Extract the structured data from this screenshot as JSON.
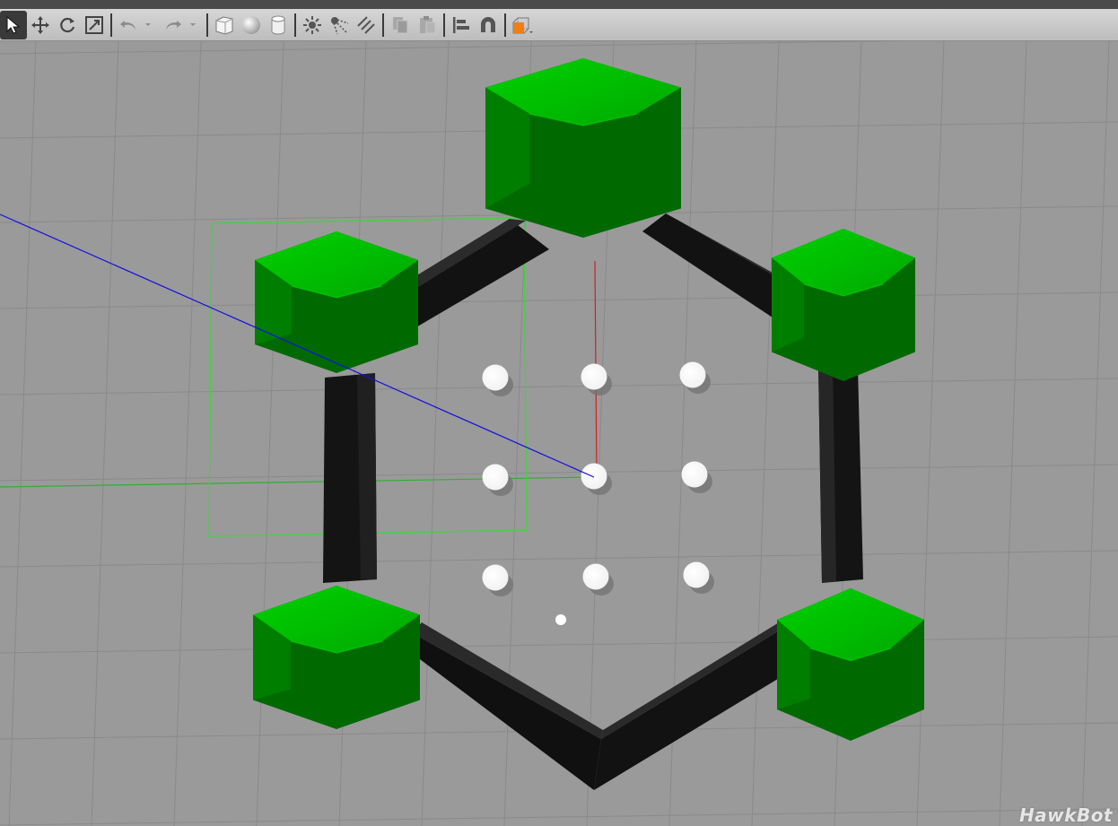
{
  "app": {
    "watermark": "HawkBot"
  },
  "toolbar": {
    "tools": [
      {
        "name": "select-mode-button",
        "icon": "arrow-cursor-icon",
        "active": true
      },
      {
        "name": "translate-mode-button",
        "icon": "move-arrows-icon"
      },
      {
        "name": "rotate-mode-button",
        "icon": "rotate-icon"
      },
      {
        "name": "scale-mode-button",
        "icon": "scale-icon"
      },
      {
        "name": "undo-button",
        "icon": "undo-icon",
        "disabled": true
      },
      {
        "name": "redo-button",
        "icon": "redo-icon",
        "disabled": true
      },
      {
        "name": "box-shape-button",
        "icon": "box-icon"
      },
      {
        "name": "sphere-shape-button",
        "icon": "sphere-icon"
      },
      {
        "name": "cylinder-shape-button",
        "icon": "cylinder-icon"
      },
      {
        "name": "point-light-button",
        "icon": "point-light-icon"
      },
      {
        "name": "spot-light-button",
        "icon": "spot-light-icon"
      },
      {
        "name": "directional-light-button",
        "icon": "directional-light-icon"
      },
      {
        "name": "copy-button",
        "icon": "copy-icon",
        "disabled": true
      },
      {
        "name": "paste-button",
        "icon": "paste-icon",
        "disabled": true
      },
      {
        "name": "align-button",
        "icon": "align-icon"
      },
      {
        "name": "snap-button",
        "icon": "magnet-icon"
      },
      {
        "name": "view-angle-button",
        "icon": "view-cube-icon"
      }
    ]
  },
  "colors": {
    "ground": "#9a9a9a",
    "grid_line": "#8a8a8a",
    "hex_green_light": "#00d000",
    "hex_green_dark": "#006a00",
    "frame_black": "#141414",
    "marker_white": "#ffffff",
    "selection_green": "#3fd43f",
    "axis_red": "#d02020",
    "axis_green": "#2fb02f",
    "axis_blue": "#1010e0",
    "accent_orange": "#f08020"
  }
}
